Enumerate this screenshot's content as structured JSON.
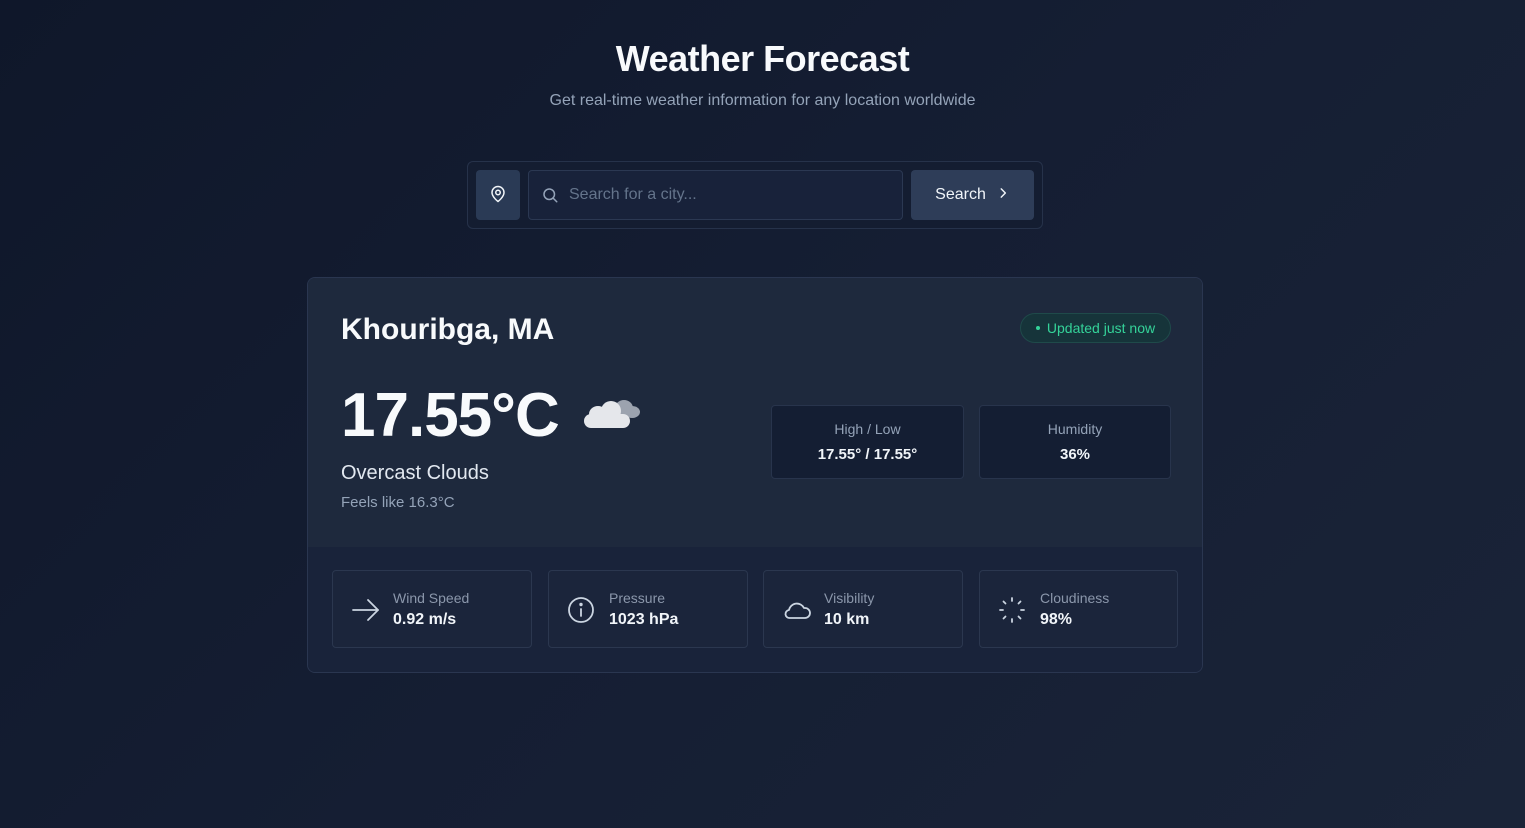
{
  "header": {
    "title": "Weather Forecast",
    "subtitle": "Get real-time weather information for any location worldwide"
  },
  "search": {
    "placeholder": "Search for a city...",
    "value": "",
    "button_label": "Search",
    "location_icon": "map-pin-icon",
    "search_icon": "search-icon"
  },
  "weather": {
    "city": "Khouribga, MA",
    "status": "Updated just now",
    "temperature": "17.55°C",
    "condition_icon": "overcast-clouds-icon",
    "description": "Overcast Clouds",
    "feels_like": "Feels like 16.3°C",
    "stats": [
      {
        "label": "High / Low",
        "value": "17.55° / 17.55°"
      },
      {
        "label": "Humidity",
        "value": "36%"
      }
    ],
    "details": [
      {
        "label": "Wind Speed",
        "value": "0.92 m/s",
        "icon": "arrow-right-icon"
      },
      {
        "label": "Pressure",
        "value": "1023 hPa",
        "icon": "info-icon"
      },
      {
        "label": "Visibility",
        "value": "10 km",
        "icon": "cloud-icon"
      },
      {
        "label": "Cloudiness",
        "value": "98%",
        "icon": "loader-icon"
      }
    ]
  },
  "colors": {
    "background": "#0f172a",
    "card": "#1e293d",
    "accent_green": "#34d399",
    "button": "#2e3d58"
  }
}
